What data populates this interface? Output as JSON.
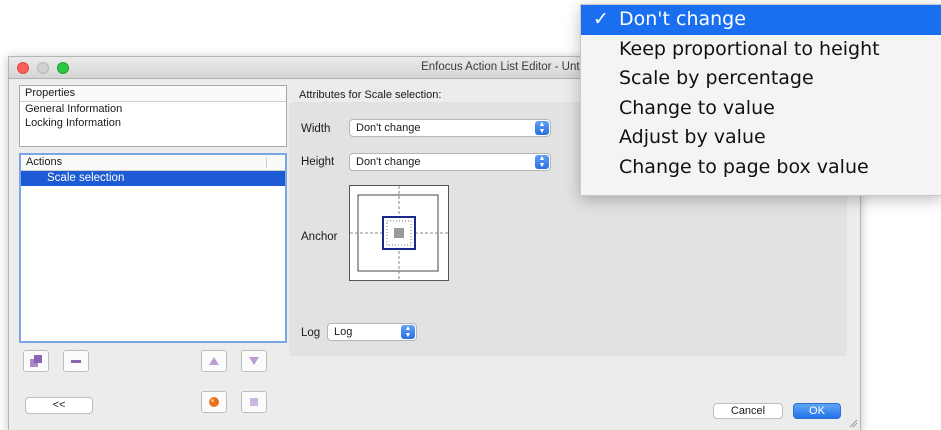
{
  "window": {
    "title": "Enfocus Action List Editor - Untitled (2)"
  },
  "properties": {
    "header": "Properties",
    "items": [
      "General Information",
      "Locking Information"
    ]
  },
  "actions": {
    "header": "Actions",
    "items": [
      "Scale selection"
    ]
  },
  "buttons": {
    "back": "<<",
    "cancel": "Cancel",
    "ok": "OK"
  },
  "attributes": {
    "title": "Attributes for Scale selection:",
    "width_label": "Width",
    "width_value": "Don't change",
    "height_label": "Height",
    "height_value": "Don't change",
    "anchor_label": "Anchor",
    "log_label": "Log",
    "log_value": "Log"
  },
  "menu": {
    "checkmark": "✓",
    "items": [
      "Don't change",
      "Keep proportional to height",
      "Scale by percentage",
      "Change to value",
      "Adjust by value",
      "Change to page box value"
    ],
    "selected_index": 0
  },
  "colors": {
    "selection": "#1d5bd4",
    "menu_highlight": "#1a6ff0",
    "accent": "#2473e8"
  }
}
